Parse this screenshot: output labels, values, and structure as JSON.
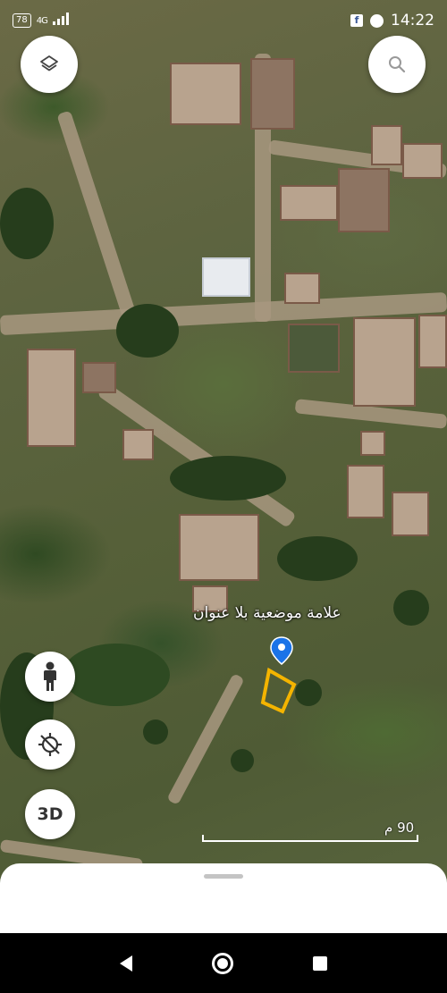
{
  "status_bar": {
    "battery": "78",
    "signal_label": "4G",
    "time": "14:22",
    "notification_icons": [
      "facebook-icon",
      "messenger-icon"
    ]
  },
  "map": {
    "place_label": "علامة موضعية بلا عنوان",
    "scale_label": "90 م",
    "pin_color": "#1a73e8",
    "plot_outline_color": "#f4b400"
  },
  "controls": {
    "layers_icon": "layers-icon",
    "search_icon": "search-icon",
    "street_view_icon": "pegman-icon",
    "location_icon": "location-off-icon",
    "three_d_label": "3D"
  },
  "navigation": {
    "icons": [
      "back-icon",
      "home-icon",
      "recents-icon"
    ]
  }
}
